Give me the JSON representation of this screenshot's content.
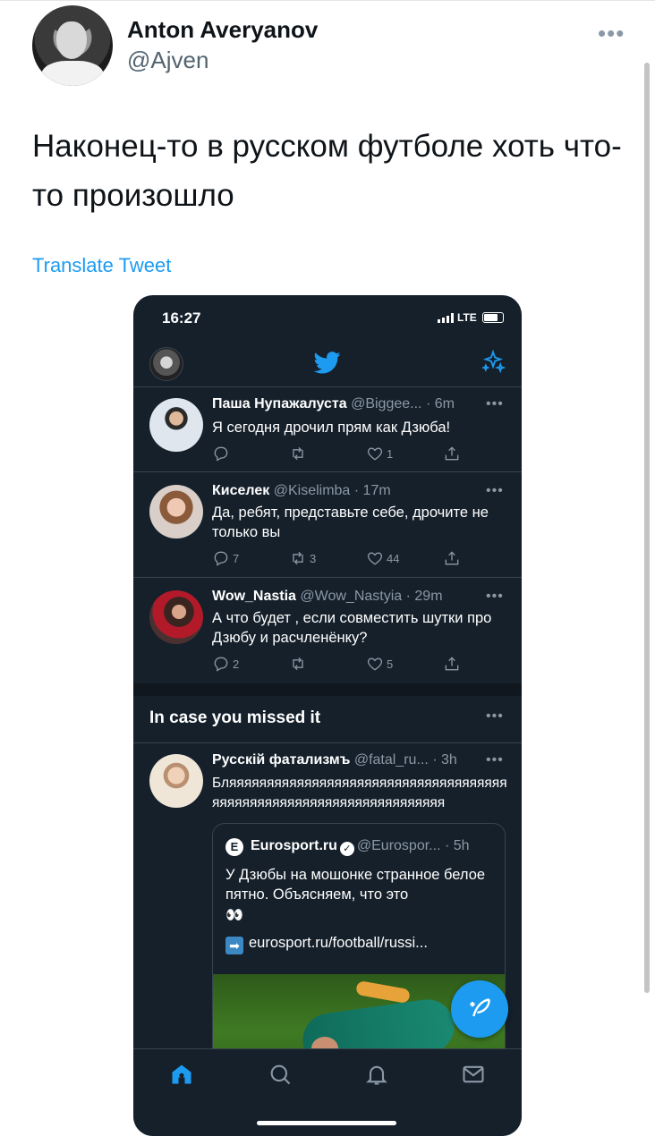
{
  "author": {
    "name": "Anton Averyanov",
    "handle": "@Ajven"
  },
  "tweet": {
    "text": "Наконец-то в русском футболе хоть что-то произошло",
    "translate_label": "Translate Tweet"
  },
  "screenshot": {
    "status_time": "16:27",
    "network": "LTE",
    "feed": [
      {
        "name": "Паша Нупажалуста",
        "handle": "@Biggee...",
        "time": "· 6m",
        "text": "Я сегодня дрочил прям как Дзюба!",
        "replies": "",
        "retweets": "",
        "likes": "1"
      },
      {
        "name": "Киселек",
        "handle": "@Kiselimba",
        "time": "· 17m",
        "text": "Да, ребят, представьте себе, дрочите не только вы",
        "replies": "7",
        "retweets": "3",
        "likes": "44"
      },
      {
        "name": "Wow_Nastia",
        "handle": "@Wow_Nastyia",
        "time": "· 29m",
        "text": "А что будет , если совместить шутки про Дзюбу и расчленёнку?",
        "replies": "2",
        "retweets": "",
        "likes": "5"
      }
    ],
    "section_title": "In case you missed it",
    "missed_tweet": {
      "name": "Русскій фатализмъ",
      "handle": "@fatal_ru...",
      "time": "· 3h",
      "text": "Бляяяяяяяяяяяяяяяяяяяяяяяяяяяяяяяяяяяяяяяяяяяяяяяяяяяяяяяяяяяяяяяяяяяя"
    },
    "quoted": {
      "logo_letter": "E",
      "name": "Eurosport.ru",
      "handle": "@Eurospor...",
      "time": "· 5h",
      "text": "У Дзюбы на мошонке странное белое пятно. Объясняем, что это",
      "eyes": "👀",
      "link_arrow": "➡",
      "link": "eurosport.ru/football/russi..."
    }
  },
  "colors": {
    "accent": "#1d9bf0",
    "dark_bg": "#15202b",
    "muted": "#8b98a5"
  }
}
